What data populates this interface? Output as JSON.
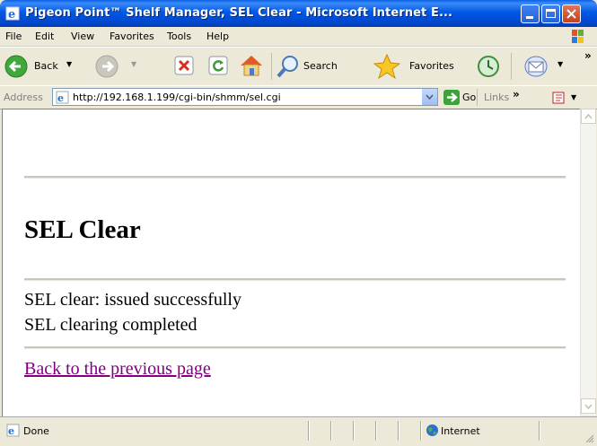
{
  "window": {
    "title": "Pigeon Point™ Shelf Manager, SEL Clear - Microsoft Internet E...",
    "accent": "#0055E5"
  },
  "menu": [
    "File",
    "Edit",
    "View",
    "Favorites",
    "Tools",
    "Help"
  ],
  "toolbar": {
    "back_label": "Back",
    "search_label": "Search",
    "favorites_label": "Favorites"
  },
  "address": {
    "label": "Address",
    "url": "http://192.168.1.199/cgi-bin/shmm/sel.cgi",
    "go_label": "Go",
    "links_label": "Links"
  },
  "page": {
    "heading": "SEL Clear",
    "messages": [
      "SEL clear: issued successfully",
      "SEL clearing completed"
    ],
    "back_link": "Back to the previous page",
    "link_color": "#800080"
  },
  "status": {
    "text": "Done",
    "zone": "Internet"
  }
}
